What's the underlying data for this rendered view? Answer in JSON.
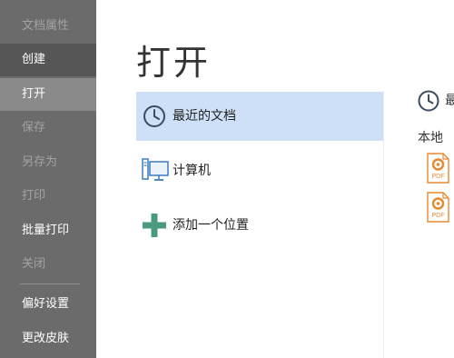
{
  "sidebar": {
    "items": [
      {
        "label": "文档属性",
        "state": "disabled"
      },
      {
        "label": "创建",
        "state": "dark"
      },
      {
        "label": "打开",
        "state": "active"
      },
      {
        "label": "保存",
        "state": "disabled"
      },
      {
        "label": "另存为",
        "state": "disabled"
      },
      {
        "label": "打印",
        "state": "disabled"
      },
      {
        "label": "批量打印",
        "state": "normal"
      },
      {
        "label": "关闭",
        "state": "disabled"
      },
      {
        "label": "偏好设置",
        "state": "normal"
      },
      {
        "label": "更改皮肤",
        "state": "normal"
      }
    ]
  },
  "main": {
    "title": "打开",
    "locations": [
      {
        "label": "最近的文档",
        "icon": "clock-icon",
        "selected": true
      },
      {
        "label": "计算机",
        "icon": "computer-icon",
        "selected": false
      },
      {
        "label": "添加一个位置",
        "icon": "plus-icon",
        "selected": false
      }
    ]
  },
  "recent_panel": {
    "title_partial": "最",
    "section_label": "本地",
    "files": [
      {
        "type": "PDF",
        "icon": "pdf-file-icon"
      },
      {
        "type": "PDF",
        "icon": "pdf-file-icon"
      }
    ]
  },
  "colors": {
    "sidebar_bg": "#6b6b6b",
    "sidebar_active": "#8a8a8a",
    "sidebar_dark": "#565656",
    "selected_bg": "#cde0f7",
    "accent_blue": "#3b7bbf",
    "plus_green": "#4a9a7f",
    "pdf_orange": "#e8892f"
  }
}
